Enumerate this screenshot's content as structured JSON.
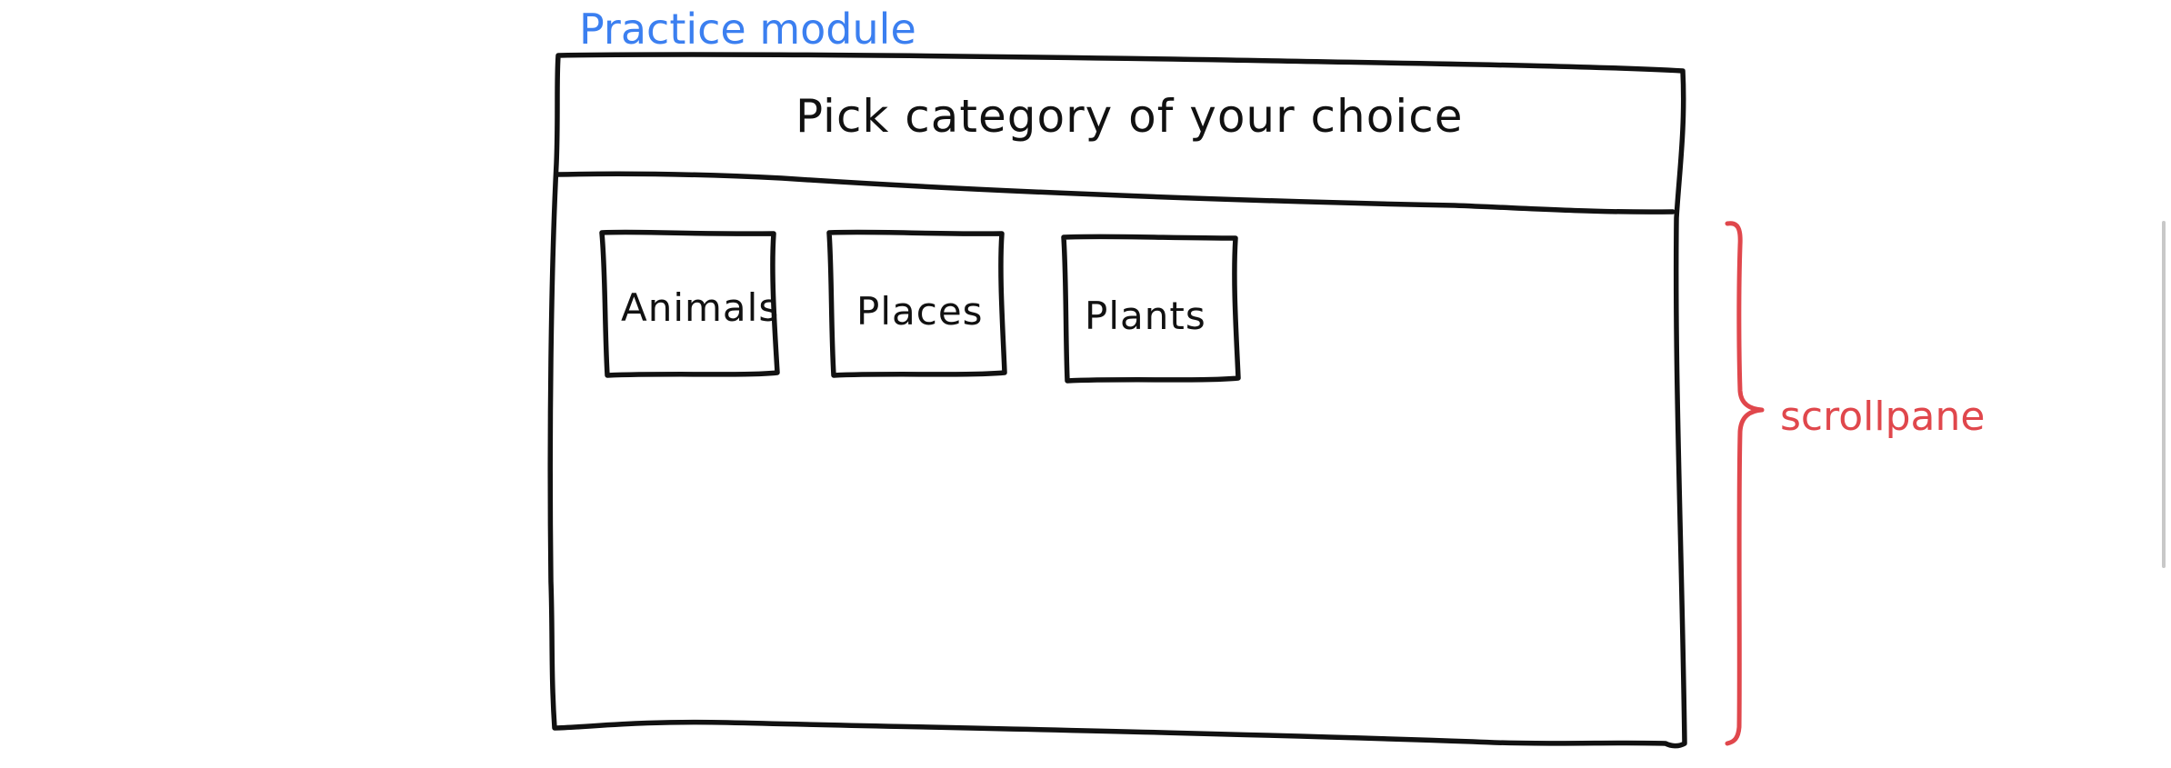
{
  "module_label": "Practice module",
  "header": {
    "title": "Pick category of your choice"
  },
  "categories": [
    {
      "label": "Animals"
    },
    {
      "label": "Places"
    },
    {
      "label": "Plants"
    }
  ],
  "scrollpane_label": "scrollpane",
  "colors": {
    "annotation_blue": "#3b7ff0",
    "annotation_red": "#e0474c",
    "ink": "#111111"
  }
}
